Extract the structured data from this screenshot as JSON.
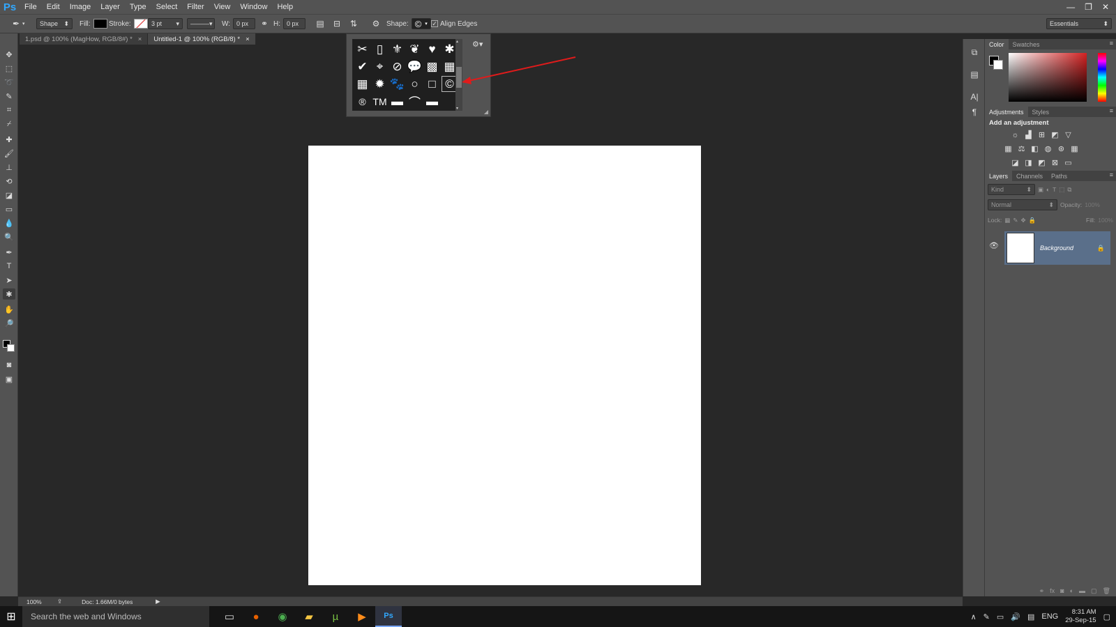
{
  "app": {
    "logo": "Ps"
  },
  "menu": [
    "File",
    "Edit",
    "Image",
    "Layer",
    "Type",
    "Select",
    "Filter",
    "View",
    "Window",
    "Help"
  ],
  "window_controls": {
    "minimize": "—",
    "restore": "❐",
    "close": "✕"
  },
  "options": {
    "mode": "Shape",
    "fill_label": "Fill:",
    "stroke_label": "Stroke:",
    "stroke_width": "3 pt",
    "w_label": "W:",
    "w_value": "0 px",
    "h_label": "H:",
    "h_value": "0 px",
    "shape_label": "Shape:",
    "shape_glyph": "©",
    "align_edges": "Align Edges",
    "align_edges_checked": true,
    "workspace": "Essentials"
  },
  "tabs": [
    {
      "label": "1.psd @ 100% (MagHow, RGB/8#) *",
      "close": "×"
    },
    {
      "label": "Untitled-1 @ 100% (RGB/8) *",
      "close": "×"
    }
  ],
  "shape_picker": {
    "shapes": [
      {
        "name": "scissors",
        "glyph": "✂"
      },
      {
        "name": "frame",
        "glyph": "▯"
      },
      {
        "name": "fleur-de-lis",
        "glyph": "⚜"
      },
      {
        "name": "ornament",
        "glyph": "❦"
      },
      {
        "name": "heart",
        "glyph": "♥"
      },
      {
        "name": "puzzle",
        "glyph": "✱"
      },
      {
        "name": "checkmark",
        "glyph": "✔"
      },
      {
        "name": "target",
        "glyph": "⌖"
      },
      {
        "name": "no-sign",
        "glyph": "⊘"
      },
      {
        "name": "speech-bubble",
        "glyph": "💬"
      },
      {
        "name": "checkerboard",
        "glyph": "▩"
      },
      {
        "name": "grid-pattern",
        "glyph": "▦"
      },
      {
        "name": "grid",
        "glyph": "▦"
      },
      {
        "name": "burst",
        "glyph": "✹"
      },
      {
        "name": "paw",
        "glyph": "🐾"
      },
      {
        "name": "circle",
        "glyph": "○"
      },
      {
        "name": "square",
        "glyph": "□"
      },
      {
        "name": "copyright",
        "glyph": "©"
      },
      {
        "name": "registered",
        "glyph": "®"
      },
      {
        "name": "trademark",
        "glyph": "TM"
      },
      {
        "name": "banner-1",
        "glyph": "▬"
      },
      {
        "name": "banner-2",
        "glyph": "⌒"
      },
      {
        "name": "banner-3",
        "glyph": "▬"
      },
      {
        "name": "empty",
        "glyph": ""
      }
    ]
  },
  "panels": {
    "color_tabs": [
      "Color",
      "Swatches"
    ],
    "adjust_tabs": [
      "Adjustments",
      "Styles"
    ],
    "adjust_title": "Add an adjustment",
    "layers_tabs": [
      "Layers",
      "Channels",
      "Paths"
    ],
    "kind": "Kind",
    "blend": "Normal",
    "opacity_label": "Opacity:",
    "opacity_value": "100%",
    "lock_label": "Lock:",
    "fill_label": "Fill:",
    "fill_value": "100%",
    "layer_name": "Background"
  },
  "status": {
    "zoom": "100%",
    "doc": "Doc: 1.66M/0 bytes"
  },
  "taskbar": {
    "search_placeholder": "Search the web and Windows",
    "apps": [
      {
        "name": "task-view",
        "glyph": "▭",
        "color": "#dddddd"
      },
      {
        "name": "firefox",
        "glyph": "●",
        "color": "#e66000"
      },
      {
        "name": "chrome",
        "glyph": "◉",
        "color": "#4caf50"
      },
      {
        "name": "file-explorer",
        "glyph": "▰",
        "color": "#f4c542"
      },
      {
        "name": "utorrent",
        "glyph": "µ",
        "color": "#78c043"
      },
      {
        "name": "media-player",
        "glyph": "▶",
        "color": "#ff8c1a"
      },
      {
        "name": "photoshop",
        "glyph": "Ps",
        "color": "#31a8ff"
      }
    ],
    "lang": "ENG",
    "time": "8:31 AM",
    "date": "29-Sep-15"
  }
}
